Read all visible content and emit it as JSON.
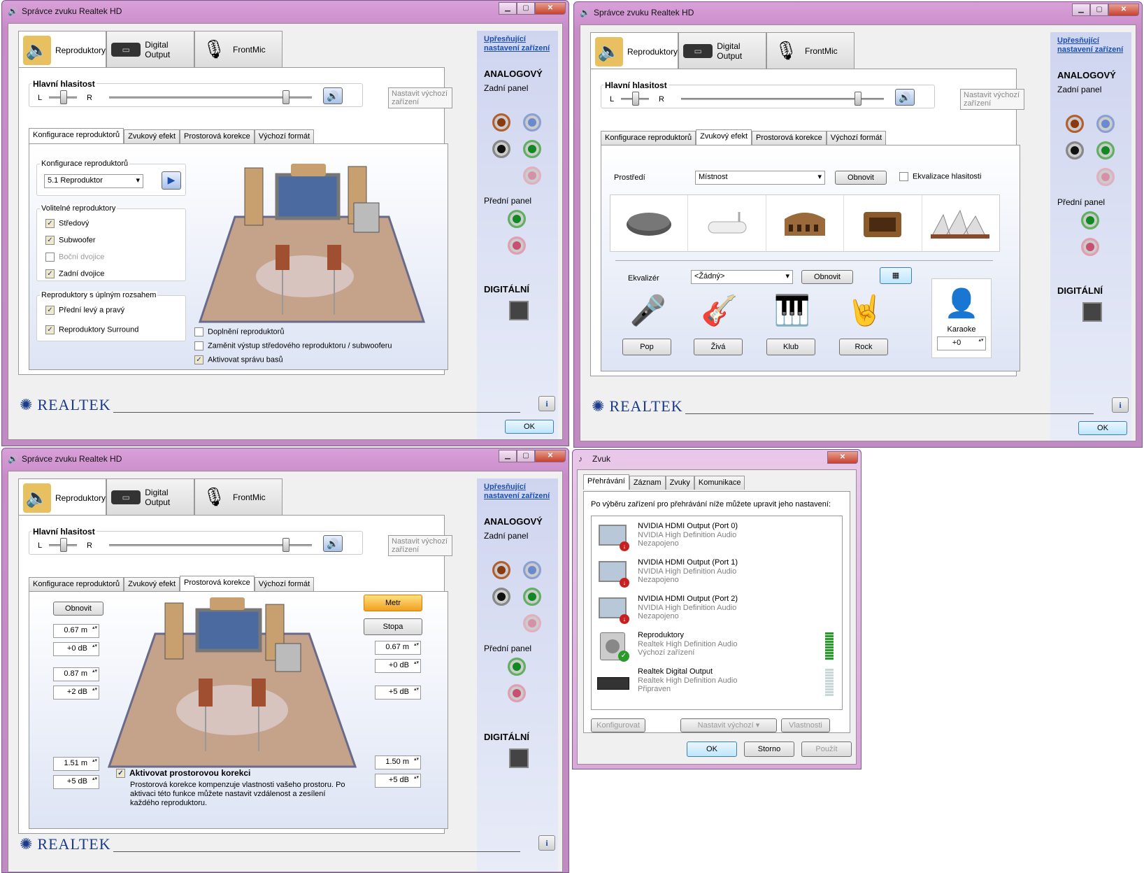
{
  "realtek": {
    "title": "Správce zvuku Realtek HD",
    "device_tabs": [
      "Reproduktory",
      "Digital Output",
      "FrontMic"
    ],
    "right_panel": {
      "link": "Upřesňující nastavení zařízení",
      "analog": "ANALOGOVÝ",
      "rear": "Zadní panel",
      "front": "Přední panel",
      "digital": "DIGITÁLNÍ"
    },
    "volume": {
      "label": "Hlavní hlasitost",
      "left": "L",
      "right": "R",
      "set_default": "Nastavit výchozí zařízení"
    },
    "sub_tabs": [
      "Konfigurace reproduktorů",
      "Zvukový efekt",
      "Prostorová korekce",
      "Výchozí formát"
    ],
    "logo": "REALTEK",
    "ok": "OK"
  },
  "config": {
    "group_label": "Konfigurace reproduktorů",
    "selected": "5.1 Reproduktor",
    "optional_label": "Volitelné reproduktory",
    "optional": [
      {
        "label": "Středový",
        "checked": true,
        "enabled": true
      },
      {
        "label": "Subwoofer",
        "checked": true,
        "enabled": true
      },
      {
        "label": "Boční dvojice",
        "checked": false,
        "enabled": false
      },
      {
        "label": "Zadní dvojice",
        "checked": true,
        "enabled": true
      }
    ],
    "fullrange_label": "Reproduktory s úplným rozsahem",
    "fullrange": [
      {
        "label": "Přední levý a pravý",
        "checked": true
      },
      {
        "label": "Reproduktory Surround",
        "checked": true
      }
    ],
    "bottom_options": [
      {
        "label": "Doplnění reproduktorů",
        "checked": false
      },
      {
        "label": "Zaměnit výstup středového reproduktoru / subwooferu",
        "checked": false
      },
      {
        "label": "Aktivovat správu basů",
        "checked": true
      }
    ]
  },
  "effects": {
    "env_label": "Prostředí",
    "env_value": "Místnost",
    "reset": "Obnovit",
    "loudness": "Ekvalizace hlasitosti",
    "eq_label": "Ekvalizér",
    "eq_value": "<Žádný>",
    "presets": [
      "Pop",
      "Živá",
      "Klub",
      "Rock"
    ],
    "karaoke": "Karaoke",
    "karaoke_value": "+0"
  },
  "room": {
    "reset": "Obnovit",
    "meter": "Metr",
    "feet": "Stopa",
    "left_values": [
      "0.67",
      "+0",
      "0.87",
      "+2",
      "1.51",
      "+5"
    ],
    "left_units": [
      "m",
      "dB",
      "m",
      "dB",
      "m",
      "dB"
    ],
    "right_values": [
      "0.67",
      "+0",
      "+5",
      "1.50",
      "+5"
    ],
    "right_units": [
      "m",
      "dB",
      "dB",
      "m",
      "dB"
    ],
    "enable_title": "Aktivovat prostorovou korekci",
    "enable_desc": "Prostorová korekce kompenzuje vlastnosti vašeho prostoru. Po aktivaci této funkce můžete nastavit vzdálenost a zesílení každého reproduktoru."
  },
  "sound": {
    "title": "Zvuk",
    "tabs": [
      "Přehrávání",
      "Záznam",
      "Zvuky",
      "Komunikace"
    ],
    "intro": "Po výběru zařízení pro přehrávání níže můžete upravit jeho nastavení:",
    "devices": [
      {
        "name": "NVIDIA HDMI Output (Port 0)",
        "driver": "NVIDIA High Definition Audio",
        "status": "Nezapojeno"
      },
      {
        "name": "NVIDIA HDMI Output (Port 1)",
        "driver": "NVIDIA High Definition Audio",
        "status": "Nezapojeno"
      },
      {
        "name": "NVIDIA HDMI Output (Port 2)",
        "driver": "NVIDIA High Definition Audio",
        "status": "Nezapojeno"
      },
      {
        "name": "Reproduktory",
        "driver": "Realtek High Definition Audio",
        "status": "Výchozí zařízení"
      },
      {
        "name": "Realtek Digital Output",
        "driver": "Realtek High Definition Audio",
        "status": "Připraven"
      }
    ],
    "configure": "Konfigurovat",
    "set_default": "Nastavit výchozí",
    "properties": "Vlastnosti",
    "ok": "OK",
    "cancel": "Storno",
    "apply": "Použít"
  },
  "colors": {
    "accent_blue": "#1a4fb0",
    "frame": "#c98cc9",
    "panel_blue": "#dde4f4"
  }
}
